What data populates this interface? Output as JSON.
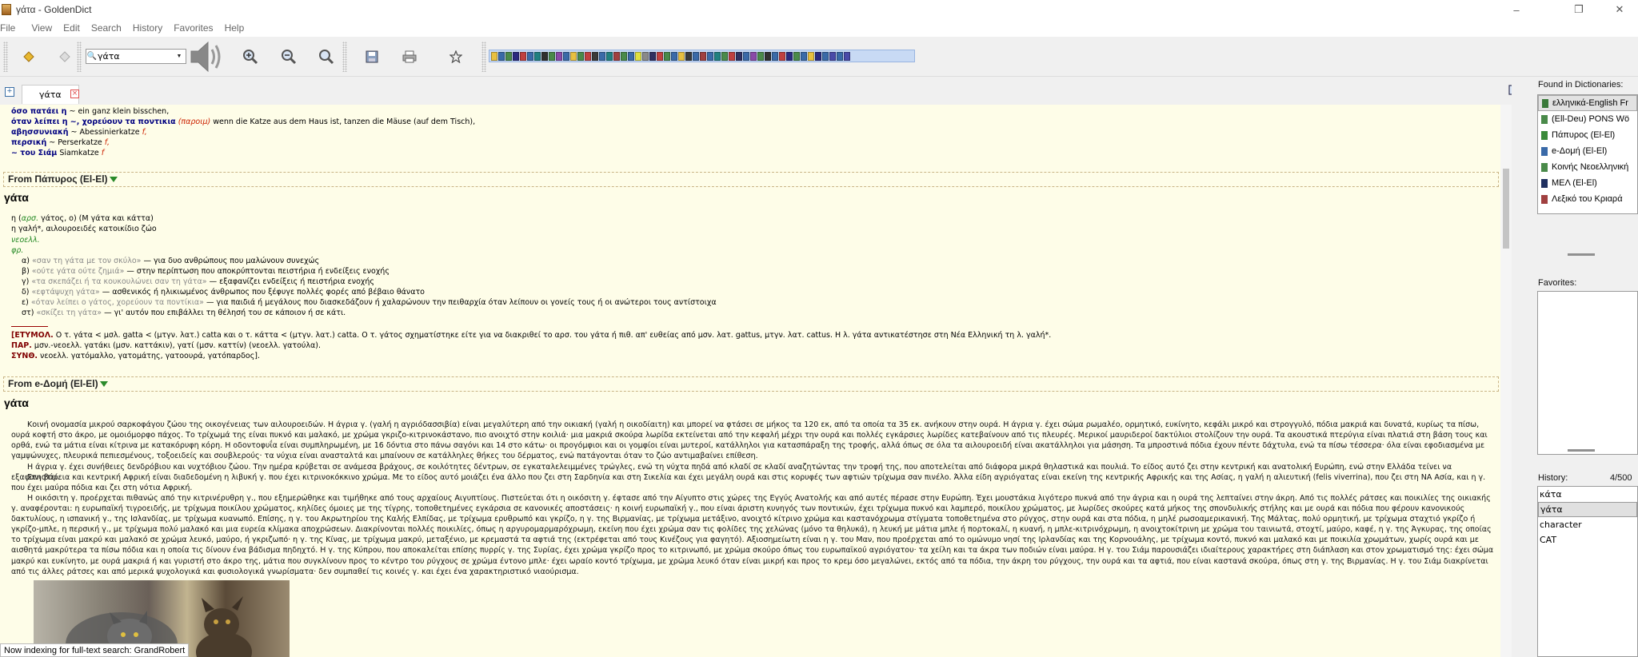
{
  "window": {
    "title": "γάτα - GoldenDict"
  },
  "menu": [
    "File",
    "View",
    "Edit",
    "Search",
    "History",
    "Favorites",
    "Help"
  ],
  "toolbar": {
    "search_value": "γάτα"
  },
  "colors": {
    "article_bg": "#fefde8",
    "dict_bar_bg": "#c8daf4",
    "headword_blue": "#000080",
    "label_green": "#228822",
    "etymology_maroon": "#800000"
  },
  "icons": [
    "back-icon",
    "forward-icon",
    "search-icon",
    "speaker-icon",
    "zoom-in-icon",
    "zoom-out-icon",
    "zoom-reset-icon",
    "save-icon",
    "print-icon",
    "favorite-star-icon",
    "new-tab-icon",
    "close-tab-icon"
  ],
  "tab": {
    "label": "γάτα"
  },
  "article": {
    "top_lines": [
      {
        "hw": "όσο πατάει η",
        "rest": " ~ ein ganz klein bisschen,"
      },
      {
        "hw": "όταν λείπει η ~, χορεύουν τα ποντικια",
        "paroim": " (παροιμ)",
        "rest": " wenn die Katze aus dem Haus ist, tanzen die Mäuse (auf dem Tisch),"
      },
      {
        "hw": "αβησσυνιακή",
        "rest": " ~ Abessinierkatze ",
        "tag": "f,"
      },
      {
        "hw": "περσική",
        "rest": " ~ Perserkatze ",
        "tag": "f,"
      },
      {
        "hw": "~ του Σιάμ",
        "rest": " Siamkatze ",
        "tag": "f"
      }
    ],
    "sections": [
      {
        "header": "From Πάπυρος (El-El)",
        "headword": "γάτα",
        "def_line1_a": "η (",
        "def_line1_b": "αρσ.",
        "def_line1_c": " γάτος, ο) (Μ γάτα και κάττα)",
        "def_line2": "η γαλή*, αιλουροειδές κατοικίδιο ζώο",
        "label_neoell": "νεοελλ.",
        "label_fr": "φρ.",
        "phrases": [
          {
            "num": "α) ",
            "phrase": "«σαν τη γάτα με τον σκύλο»",
            "gloss": " — για δυο ανθρώπους που μαλώνουν συνεχώς"
          },
          {
            "num": "β) ",
            "phrase": "«ούτε γάτα ούτε ζημιά»",
            "gloss": " — στην περίπτωση που αποκρύπτονται πειστήρια ή ενδείξεις ενοχής"
          },
          {
            "num": "γ) ",
            "phrase": "«τα σκεπάζει ή τα κουκουλώνει σαν τη γάτα»",
            "gloss": " — εξαφανίζει ενδείξεις ή πειστήρια ενοχής"
          },
          {
            "num": "δ) ",
            "phrase": "«εφτάψυχη γάτα»",
            "gloss": " — ασθενικός ή ηλικιωμένος άνθρωπος που ξέφυγε πολλές φορές από βέβαιο θάνατο"
          },
          {
            "num": "ε) ",
            "phrase": "«όταν λείπει ο γάτος, χορεύουν τα ποντίκια»",
            "gloss": " — για παιδιά ή μεγάλους που διασκεδάζουν ή χαλαρώνουν την πειθαρχία όταν λείπουν οι γονείς τους ή οι ανώτεροι τους αντίστοιχα"
          },
          {
            "num": "στ) ",
            "phrase": "«σκίζει τη γάτα»",
            "gloss": " — γι' αυτόν που επιβάλλει τη θέλησή του σε κάποιον ή σε κάτι."
          }
        ],
        "etym_label": "[ΕΤΥΜΟΛ.",
        "etym_text": " Ο τ. γάτα < μσλ. gatta < (μτγν. λατ.) catta και ο τ. κάττα < (μτγν. λατ.) catta. Ο τ. γάτος σχηματίστηκε είτε για να διακριθεί το αρσ. του γάτα ή πιθ. απ' ευθείας από μσν. λατ. gattus, μτγν. λατ. cattus. Η λ. γάτα αντικατέστησε στη Νέα Ελληνική τη λ. γαλή*.",
        "par_label": "ΠΑΡ.",
        "par_text": " μσν.-νεοελλ. γατάκι (μσν. καττάκιν), γατί (μσν. καττίν) (νεοελλ. γατούλα).",
        "syno_label": "ΣΥΝΘ.",
        "syno_text": " νεοελλ. γατόμαλλο, γατομάτης, γατοουρά, γατόπαρδος]."
      },
      {
        "header": "From e-Δομή (El-El)",
        "headword": "γάτα",
        "paragraphs": [
          "Κοινή ονομασία μικρού σαρκοφάγου ζώου της οικογένειας των αιλουροειδών. Η άγρια γ. (γαλή η αγριόδασσιβία) είναι μεγαλύτερη από την οικιακή (γαλή η οικοδίαιτη) και μπορεί να φτάσει σε μήκος τα 120 εκ, από τα οποία τα 35 εκ. ανήκουν στην ουρά. Η άγρια γ. έχει σώμα ρωμαλέο, ορμητικό, ευκίνητο, κεφάλι μικρό και στρογγυλό, πόδια μακριά και δυνατά, κυρίως τα πίσω, ουρά κοφτή στο άκρο, με ομοιόμορφο πάχος. Το τρίχωμά της είναι πυκνό και μαλακό, με χρώμα γκριζο-κιτρινοκάστανο, πιο ανοιχτό στην κοιλιά· μια μακριά σκούρα λωρίδα εκτείνεται από την κεφαλή μέχρι την ουρά και πολλές εγκάρσιες λωρίδες κατεβαίνουν από τις πλευρές. Μερικοί μαυριδεροί δακτύλιοι στολίζουν την ουρά. Τα ακουστικά πτερύγια είναι πλατιά στη βάση τους και ορθά, ενώ τα μάτια είναι κίτρινα με κατακόρυφη κόρη. Η οδοντοφυΐα είναι συμπληρωμένη, με 16 δόντια στο πάνω σαγόνι και 14 στο κάτω· οι προγόμφιοι και οι γομφίοι είναι μυτεροί, κατάλληλοι για κατασπάραξη της τροφής, αλλά όπως σε όλα τα αιλουροειδή είναι ακατάλληλοι για μάσηση. Τα μπροστινά πόδια έχουν πέντε δάχτυλα, ενώ τα πίσω τέσσερα· όλα είναι εφοδιασμένα με γαμψώνυχες, πλευρικά πεπιεσμένους, τοξοειδείς και σουβλερούς· τα νύχια είναι ανασταλτά και μπαίνουν σε κατάλληλες θήκες του δέρματος, ενώ πατάγονται όταν το ζώο αντιμαβαίνει επίθεση.",
          "Η άγρια γ. έχει συνήθειες δενδρόβιου και νυχτόβιου ζώου. Την ημέρα κρύβεται σε ανάμεσα βράχους, σε κοιλότητες δέντρων, σε εγκαταλελειμμένες τρώγλες, ενώ τη νύχτα πηδά από κλαδί σε κλαδί αναζητώντας την τροφή της, που αποτελείται από διάφορα μικρά θηλαστικά και πουλιά. Το είδος αυτό ζει στην κεντρική και ανατολική Ευρώπη, ενώ στην Ελλάδα τείνει να εξαφανιστεί.",
          "Στη βόρεια και κεντρική Αφρική είναι διαδεδομένη η λιβυκή γ. που έχει κιτρινοκόκκινο χρώμα. Με το είδος αυτό μοιάζει ένα άλλο που ζει στη Σαρδηνία και στη Σικελία και έχει μεγάλη ουρά και στις κορυφές των αφτιών τρίχωμα σαν πινέλο. Άλλα είδη αγριόγατας είναι εκείνη της κεντρικής Αφρικής και της Ασίας, η γαλή η αλιευτική (felis viverrina), που ζει στη ΝΑ Ασία, και η γ. που έχει μαύρα πόδια και ζει στη νότια Αφρική.",
          "Η οικόσιτη γ. προέρχεται πιθανώς από την κιτρινέρυθρη γ., που εξημερώθηκε και τιμήθηκε από τους αρχαίους Αιγυπτίους. Πιστεύεται ότι η οικόσιτη γ. έφτασε από την Αίγυπτο στις χώρες της Εγγύς Ανατολής και από αυτές πέρασε στην Ευρώπη. Έχει μουστάκια λιγότερο πυκνά από την άγρια και η ουρά της λεπταίνει στην άκρη. Από τις πολλές ράτσες και ποικιλίες της οικιακής γ. αναφέρονται: η ευρωπαϊκή τιγροειδής, με τρίχωμα ποικίλου χρώματος, κηλίδες όμοιες με της τίγρης, τοποθετημένες εγκάρσια σε κανονικές αποστάσεις· η κοινή ευρωπαϊκή γ., που είναι άριστη κυνηγός των ποντικών, έχει τρίχωμα πυκνό και λαμπερό, ποικίλου χρώματος, με λωρίδες σκούρες κατά μήκος της σπονδυλικής στήλης και με ουρά και πόδια που φέρουν κανονικούς δακτυλίους, η ισπανική γ., της Ισλανδίας, με τρίχωμα κυανωπό. Επίσης, η γ. του Ακρωτηρίου της Καλής Ελπίδας, με τρίχωμα ερυθρωπό και γκρίζο, η γ. της Βιρμανίας, με τρίχωμα μετάξινο, ανοιχτό κίτρινο χρώμα και καστανόχρωμα στίγματα τοποθετημένα στο ρύγχος, στην ουρά και στα πόδια, η μηλέ ρωσοαμερικανική. Της Μάλτας, πολύ ορμητική, με τρίχωμα σταχτιό γκρίζο ή γκρίζο-μπλε, η περσική γ., με τρίχωμα πολύ μαλακό και μια ευρεία κλίμακα αποχρώσεων. Διακρίνονται πολλές ποικιλίες, όπως η αργυρομαρμαρόχρωμη, εκείνη που έχει χρώμα σαν τις φολίδες της χελώνας (μόνο τα θηλυκά), η λευκή με μάτια μπλε ή πορτοκαλί, η κυανή, η μπλε-κιτρινόχρωμη, η ανοιχτοκίτρινη με χρώμα του ταινιωτά, στοχτί, μαύρο, καφέ, η γ. της Άγκυρας, της οποίας το τρίχωμα είναι μακρύ και μαλακό σε χρώμα λευκό, μαύρο, ή γκριζωπό· η γ. της Κίνας, με τρίχωμα μακρύ, μεταξένιο, με κρεμαστά τα αφτιά της (εκτρέφεται από τους Κινέζους για φαγητό). Αξιοσημείωτη είναι η γ. του Μαν, που προέρχεται από το ομώνυμο νησί της Ιρλανδίας και της Κορνουάλης, με τρίχωμα κοντό, πυκνό και μαλακό και με ποικιλία χρωμάτων, χωρίς ουρά και με αισθητά μακρύτερα τα πίσω πόδια και η οποία τις δίνουν ένα βάδισμα πηδηχτό. Η γ. της Κύπρου, που αποκαλείται επίσης πυρρίς γ. της Συρίας, έχει χρώμα γκρίζο προς το κιτρινωπό, με χρώμα σκούρο όπως του ευρωπαϊκού αγριόγατου· τα χείλη και τα άκρα των ποδιών είναι μαύρα. Η γ. του Σιάμ παρουσιάζει ιδιαίτερους χαρακτήρες στη διάπλαση και στον χρωματισμό της: έχει σώμα μακρύ και ευκίνητο, με ουρά μακριά ή και γυριστή στο άκρο της, μάτια που συγκλίνουν προς το κέντρο του ρύγχους σε χρώμα έντονο μπλε· έχει ωραίο κοντό τρίχωμα, με χρώμα λευκό όταν είναι μικρή και προς το κρεμ όσο μεγαλώνει, εκτός από τα πόδια, την άκρη του ρύγχους, την ουρά και τα αφτιά, που είναι καστανά σκούρα, όπως στη γ. της Βιρμανίας. Η γ. του Σιάμ διακρίνεται από τις άλλες ράτσες και από μερικά ψυχολογικά και φυσιολογικά γνωρίσματα· δεν συμπαθεί τις κοινές γ. και έχει ένα χαρακτηριστικό νιαούρισμα."
        ]
      }
    ]
  },
  "status": "Now indexing for full-text search: GrandRobert",
  "right_dock": {
    "found_label": "Found in Dictionaries:",
    "dictionaries": [
      {
        "name": "ελληνικά-English Fr",
        "color": "#3a7a3a"
      },
      {
        "name": "(Ell-Deu) PONS Wö",
        "color": "#4a8a4a"
      },
      {
        "name": "Πάπυρος (El-El)",
        "color": "#3a8a3a"
      },
      {
        "name": "e-Δομή (El-El)",
        "color": "#3a6aa8"
      },
      {
        "name": "Κοινής Νεοελληνική",
        "color": "#4a8a4a"
      },
      {
        "name": "ΜΕΛ (El-El)",
        "color": "#203060"
      },
      {
        "name": "Λεξικό του Κριαρά",
        "color": "#a04040"
      }
    ],
    "favorites_label": "Favorites:",
    "history_label": "History:",
    "history_count": "4/500",
    "history": [
      "κάτα",
      "γάτα",
      "character",
      "CAT"
    ]
  }
}
